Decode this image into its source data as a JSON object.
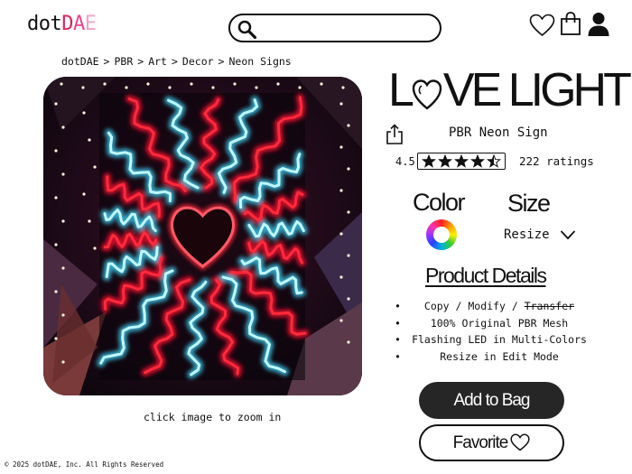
{
  "header": {
    "logo": {
      "part1": "dot",
      "part2": "D",
      "part3": "A",
      "part4": "E"
    },
    "search": {
      "placeholder": ""
    },
    "icons": [
      "heart-icon",
      "shopping-bag-icon",
      "user-icon"
    ]
  },
  "breadcrumb": [
    "dotDAE",
    "PBR",
    "Art",
    "Decor",
    "Neon Signs"
  ],
  "product": {
    "title_prefix": "L",
    "title_suffix": "VE LIGHT",
    "subtitle": "PBR Neon Sign",
    "rating": "4.5",
    "rating_value": 4.5,
    "rating_max": 5,
    "ratings_count": "222 ratings",
    "color_label": "Color",
    "size_label": "Size",
    "size_value": "Resize",
    "details_heading": "Product Details",
    "features": [
      {
        "a": "Copy / Modify / ",
        "b": "Transfer"
      },
      {
        "a": "100% Original PBR Mesh"
      },
      {
        "a": "Flashing LED in Multi-Colors"
      },
      {
        "a": "Resize in Edit Mode"
      }
    ],
    "add_to_bag": "Add to Bag",
    "favorite": "Favorite"
  },
  "hero": {
    "hint": "click image to zoom in"
  },
  "footer": {
    "copyright": "© 2025 dotDAE, Inc. All Rights Reserved"
  },
  "colors": {
    "neon_red": "#ff2a3c",
    "neon_cyan": "#bff8ff",
    "brand_pink": "#e0215a",
    "button_dark": "#262626"
  }
}
